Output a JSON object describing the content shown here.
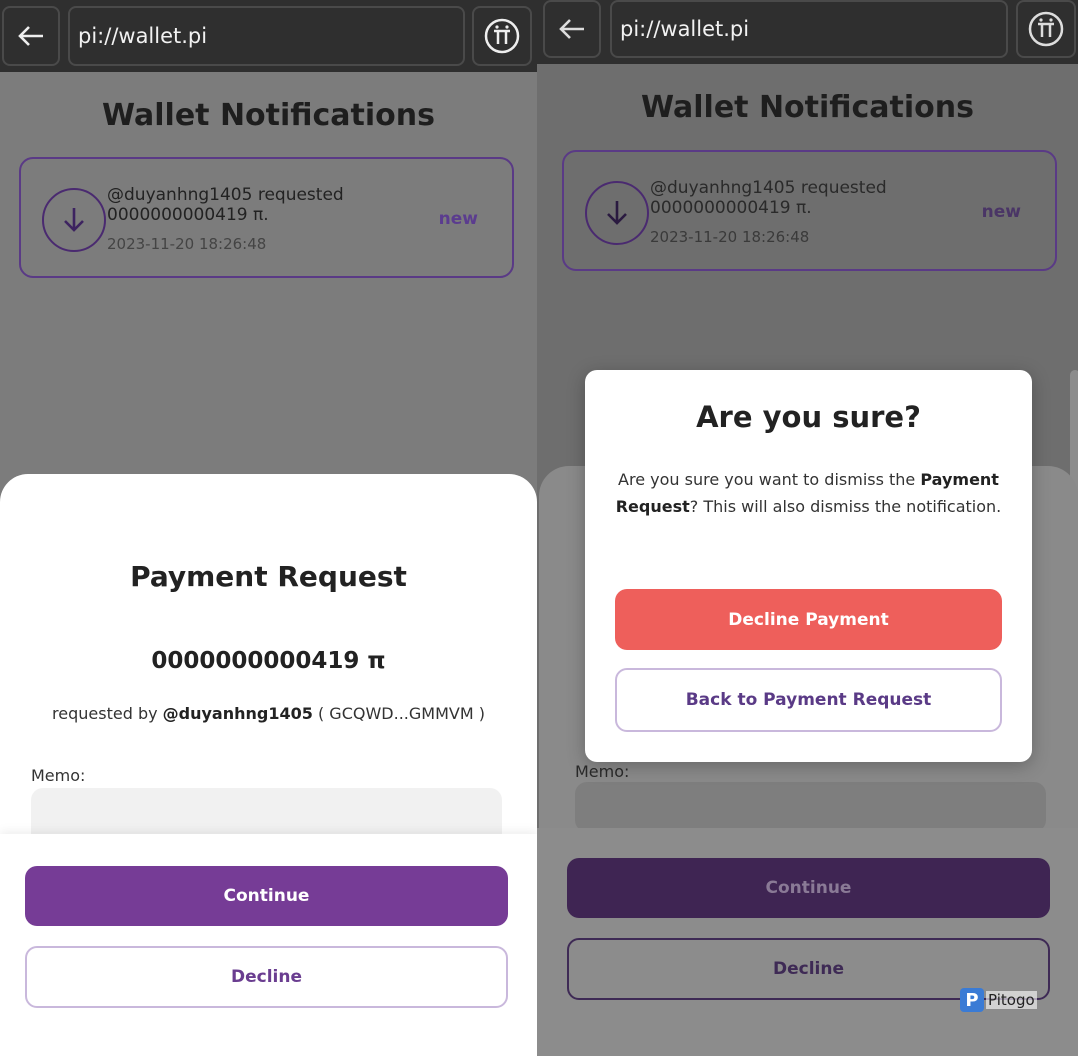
{
  "left": {
    "url": "pi://wallet.pi",
    "page_title": "Wallet Notifications",
    "notification": {
      "line1": "@duyanhng1405 requested",
      "line2": "0000000000419 π.",
      "date": "2023-11-20 18:26:48",
      "status": "new"
    },
    "sheet": {
      "title": "Payment Request",
      "amount": "0000000000419 π",
      "requested_prefix": "requested by ",
      "requested_user": "@duyanhng1405",
      "requested_address": " ( GCQWD...GMMVM )",
      "memo_label": "Memo:",
      "continue_label": "Continue",
      "decline_label": "Decline"
    }
  },
  "right": {
    "url": "pi://wallet.pi",
    "page_title": "Wallet Notifications",
    "notification": {
      "line1": "@duyanhng1405 requested",
      "line2": "0000000000419 π.",
      "date": "2023-11-20 18:26:48",
      "status": "new"
    },
    "memo_label": "Memo:",
    "continue_label": "Continue",
    "decline_label": "Decline",
    "modal": {
      "title": "Are you sure?",
      "body_pre": "Are you sure you want to dismiss the ",
      "body_bold": "Payment Request",
      "body_post": "? This will also dismiss the notification.",
      "confirm_label": "Decline Payment",
      "back_label": "Back to Payment Request"
    }
  },
  "watermark": {
    "text": "Pitogo",
    "logo_letter": "P"
  },
  "colors": {
    "accent_purple": "#763c96",
    "danger_red": "#ee5f5b",
    "topbar": "#2f2f2f"
  },
  "icons": [
    "back-arrow-icon",
    "pi-coin-icon",
    "download-arrow-icon"
  ]
}
